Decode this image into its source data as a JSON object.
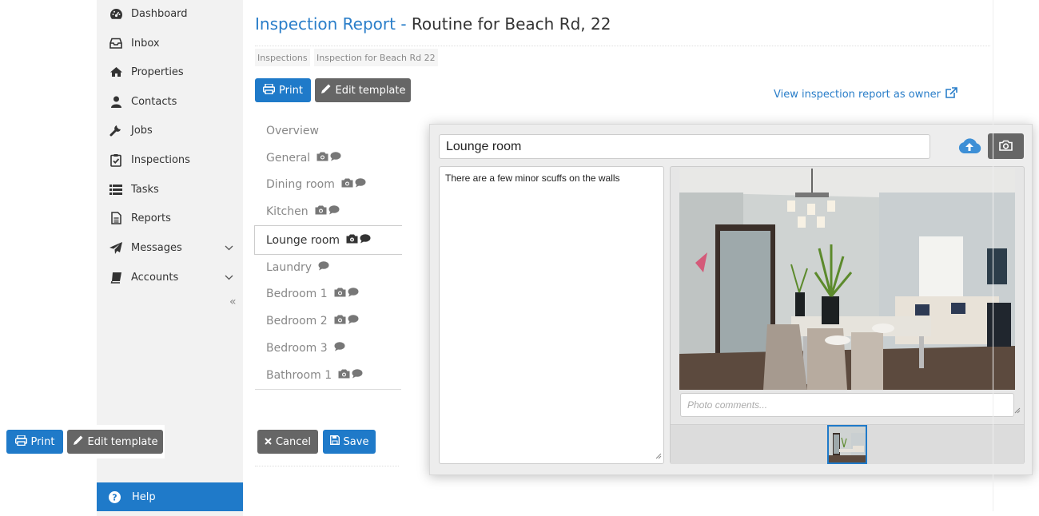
{
  "sidebar": {
    "items": [
      {
        "label": "Dashboard",
        "icon": "dashboard-icon"
      },
      {
        "label": "Inbox",
        "icon": "inbox-icon"
      },
      {
        "label": "Properties",
        "icon": "home-icon"
      },
      {
        "label": "Contacts",
        "icon": "user-icon"
      },
      {
        "label": "Jobs",
        "icon": "wrench-icon"
      },
      {
        "label": "Inspections",
        "icon": "clipboard-check-icon"
      },
      {
        "label": "Tasks",
        "icon": "list-icon"
      },
      {
        "label": "Reports",
        "icon": "document-icon"
      },
      {
        "label": "Messages",
        "icon": "paper-plane-icon"
      },
      {
        "label": "Accounts",
        "icon": "book-icon"
      }
    ],
    "collapse_glyph": "«",
    "help_label": "Help"
  },
  "header": {
    "title_prefix": "Inspection Report -",
    "title_rest": "Routine for Beach Rd, 22",
    "breadcrumbs": [
      "Inspections",
      "Inspection for Beach Rd 22"
    ]
  },
  "toolbar": {
    "print_label": "Print",
    "edit_template_label": "Edit template",
    "owner_link_label": "View inspection report as owner"
  },
  "rooms": [
    {
      "label": "Overview",
      "photo": false,
      "comment": false
    },
    {
      "label": "General",
      "photo": true,
      "comment": true
    },
    {
      "label": "Dining room",
      "photo": true,
      "comment": true
    },
    {
      "label": "Kitchen",
      "photo": true,
      "comment": true
    },
    {
      "label": "Lounge room",
      "photo": true,
      "comment": true,
      "active": true
    },
    {
      "label": "Laundry",
      "photo": false,
      "comment": true
    },
    {
      "label": "Bedroom 1",
      "photo": true,
      "comment": true
    },
    {
      "label": "Bedroom 2",
      "photo": true,
      "comment": true
    },
    {
      "label": "Bedroom 3",
      "photo": false,
      "comment": true
    },
    {
      "label": "Bathroom 1",
      "photo": true,
      "comment": true
    }
  ],
  "actions": {
    "cancel_label": "Cancel",
    "save_label": "Save"
  },
  "editor": {
    "room_name": "Lounge room",
    "notes": "There are a few minor scuffs on the walls",
    "photo_comments_placeholder": "Photo comments..."
  },
  "colors": {
    "accent": "#1f7ac9",
    "title_blue": "#2a7ec9",
    "button_gray": "#666666"
  }
}
